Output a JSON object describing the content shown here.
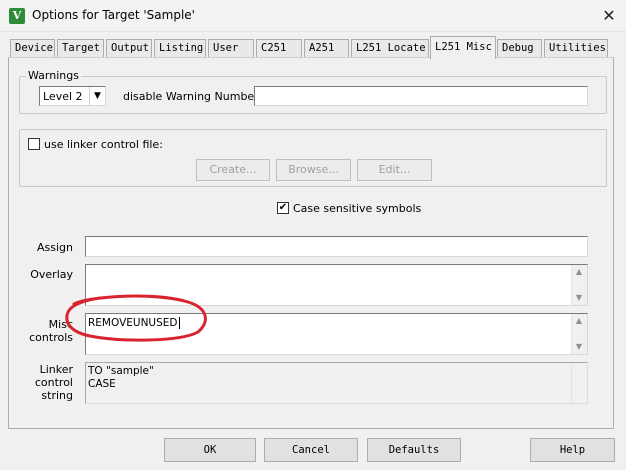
{
  "window": {
    "title": "Options for Target 'Sample'",
    "app_icon_glyph": "V",
    "close_glyph": "✕"
  },
  "tabs": [
    {
      "label": "Device"
    },
    {
      "label": "Target"
    },
    {
      "label": "Output"
    },
    {
      "label": "Listing"
    },
    {
      "label": "User"
    },
    {
      "label": "C251"
    },
    {
      "label": "A251"
    },
    {
      "label": "L251 Locate"
    },
    {
      "label": "L251 Misc"
    },
    {
      "label": "Debug"
    },
    {
      "label": "Utilities"
    }
  ],
  "active_tab": "L251 Misc",
  "warnings": {
    "group_label": "Warnings",
    "level_value": "Level 2",
    "disable_label": "disable Warning Numbers:",
    "disable_value": ""
  },
  "linker_control_file": {
    "checkbox_label": "use linker control file:",
    "checked": false,
    "create_label": "Create...",
    "browse_label": "Browse...",
    "edit_label": "Edit..."
  },
  "case_sensitive": {
    "label": "Case sensitive symbols",
    "checked": true,
    "check_glyph": "✔"
  },
  "assign": {
    "label": "Assign",
    "value": ""
  },
  "overlay": {
    "label": "Overlay",
    "value": ""
  },
  "misc_controls": {
    "label_line1": "Misc",
    "label_line2": "controls",
    "value": "REMOVEUNUSED"
  },
  "linker_control_string": {
    "label_line1": "Linker",
    "label_line2": "control",
    "label_line3": "string",
    "lines": [
      "TO \"sample\"",
      "CASE"
    ]
  },
  "footer": {
    "ok_label": "OK",
    "cancel_label": "Cancel",
    "defaults_label": "Defaults",
    "help_label": "Help"
  },
  "annotation": {
    "color": "#d8242f"
  },
  "icons": {
    "dropdown": "▼",
    "scroll_up": "▲",
    "scroll_down": "▼"
  }
}
